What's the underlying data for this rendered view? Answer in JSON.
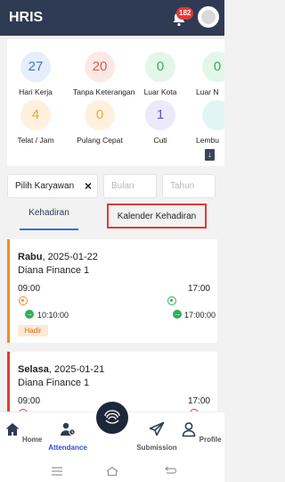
{
  "appbar": {
    "title": "HRIS",
    "notif_count": "182"
  },
  "stats": [
    {
      "value": "27",
      "label": "Hari Kerja"
    },
    {
      "value": "20",
      "label": "Tanpa Keterangan"
    },
    {
      "value": "0",
      "label": "Luar Kota"
    },
    {
      "value": "0",
      "label": "Luar N"
    },
    {
      "value": "4",
      "label": "Telat / Jam"
    },
    {
      "value": "0",
      "label": "Pulang Cepat"
    },
    {
      "value": "1",
      "label": "Cuti"
    },
    {
      "value": "",
      "label": "Lembu"
    }
  ],
  "filters": {
    "employee_label": "Pilih Karyawan",
    "month_placeholder": "Bulan",
    "year_placeholder": "Tahun"
  },
  "tabs": {
    "attendance": "Kehadiran",
    "calendar": "Kalender Kehadiran"
  },
  "records": [
    {
      "day": "Rabu",
      "date": ", 2025-01-22",
      "name": "Diana Finance 1",
      "sched_in": "09:00",
      "sched_out": "17:00",
      "actual_in": "10:10:00",
      "actual_out": "17:00:00",
      "status": "Hadir"
    },
    {
      "day": "Selasa",
      "date": ", 2025-01-21",
      "name": "Diana Finance 1",
      "sched_in": "09:00",
      "sched_out": "17:00"
    }
  ],
  "bottom_nav": {
    "home": "Home",
    "attendance": "Attendance",
    "submission": "Submission",
    "profile": "Profile"
  }
}
